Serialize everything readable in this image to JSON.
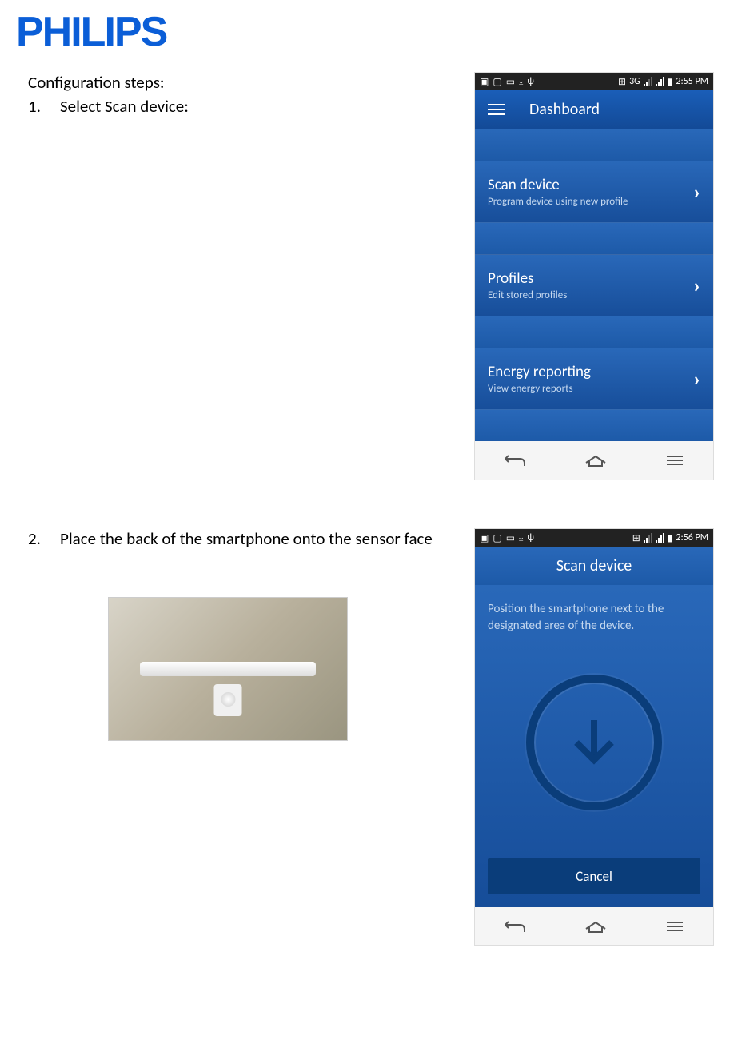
{
  "logo": "PHILIPS",
  "heading": "Configuration steps:",
  "step1_num": "1.",
  "step1_text": "Select Scan device:",
  "step2_num": "2.",
  "step2_text": "Place the back of the smartphone onto the sensor face",
  "screenshot1": {
    "status_time": "2:55 PM",
    "status_3g": "3G",
    "header_title": "Dashboard",
    "items": [
      {
        "title": "Scan device",
        "sub": "Program device using new profile"
      },
      {
        "title": "Profiles",
        "sub": "Edit stored profiles"
      },
      {
        "title": "Energy reporting",
        "sub": "View energy reports"
      }
    ]
  },
  "screenshot2": {
    "status_time": "2:56 PM",
    "header_title": "Scan device",
    "instruction": "Position the smartphone next to the designated area of the device.",
    "cancel_label": "Cancel"
  }
}
